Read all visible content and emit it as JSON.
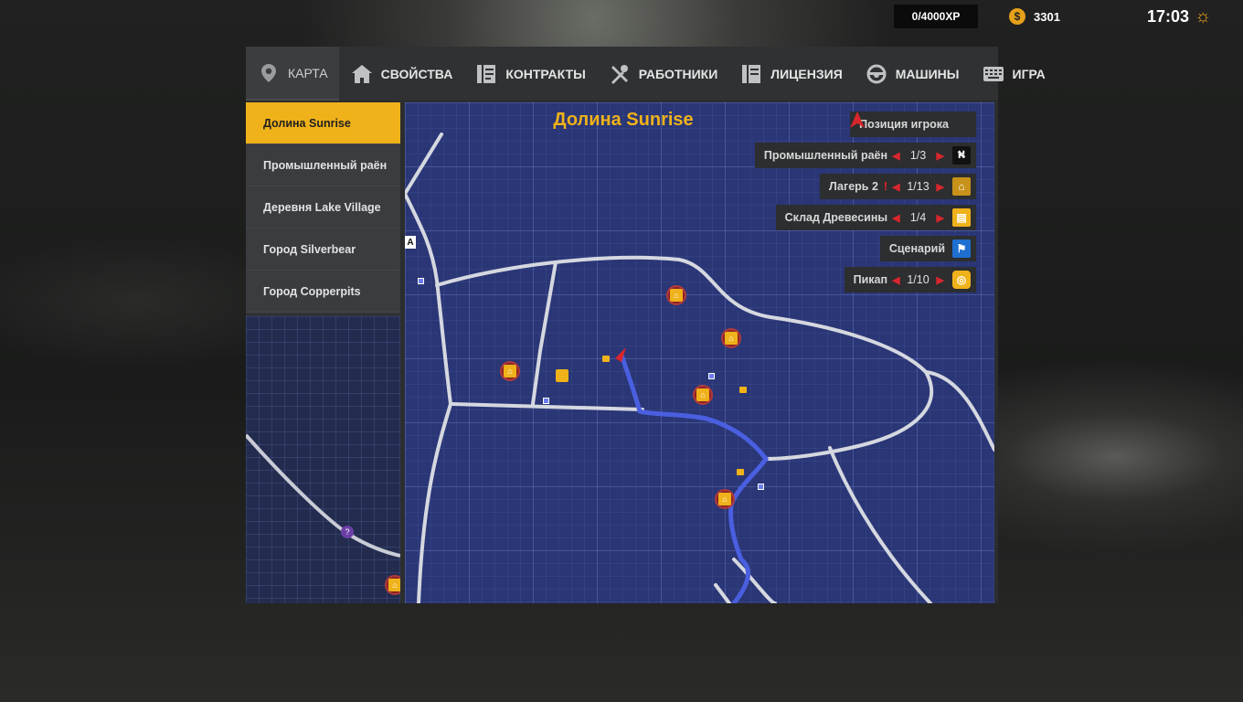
{
  "hud": {
    "xp": "0/4000XP",
    "money": "3301",
    "coin_symbol": "$",
    "time": "17:03"
  },
  "tabs": [
    {
      "label": "КАРТА",
      "icon": "map-pin-icon"
    },
    {
      "label": "СВОЙСТВА",
      "icon": "house-icon"
    },
    {
      "label": "КОНТРАКТЫ",
      "icon": "contract-icon"
    },
    {
      "label": "РАБОТНИКИ",
      "icon": "tools-icon"
    },
    {
      "label": "ЛИЦЕНЗИЯ",
      "icon": "license-icon"
    },
    {
      "label": "МАШИНЫ",
      "icon": "steering-wheel-icon"
    },
    {
      "label": "ИГРА",
      "icon": "keyboard-icon"
    }
  ],
  "sidebar": {
    "items": [
      {
        "label": "Долина Sunrise"
      },
      {
        "label": "Промышленный раён"
      },
      {
        "label": "Деревня Lake Village"
      },
      {
        "label": "Город Silverbear"
      },
      {
        "label": "Город Copperpits"
      }
    ]
  },
  "map": {
    "title": "Долина Sunrise",
    "legend": [
      {
        "label": "Позиция игрока",
        "icon": "player-arrow-icon"
      },
      {
        "label": "Промышленный раён",
        "count": "1/3",
        "icon": "road-icon"
      },
      {
        "label": "Лагерь 2",
        "count": "1/13",
        "icon": "camp-icon",
        "alert": "!"
      },
      {
        "label": "Склад Древесины",
        "count": "1/4",
        "icon": "lumber-icon"
      },
      {
        "label": "Сценарий",
        "icon": "scenario-flag-icon"
      },
      {
        "label": "Пикап",
        "count": "1/10",
        "icon": "pickup-icon"
      }
    ],
    "colors": {
      "accent": "#f0b21a",
      "route": "#4a5fe0",
      "map_bg": "#2a3675",
      "arrow": "#d8262c"
    }
  }
}
